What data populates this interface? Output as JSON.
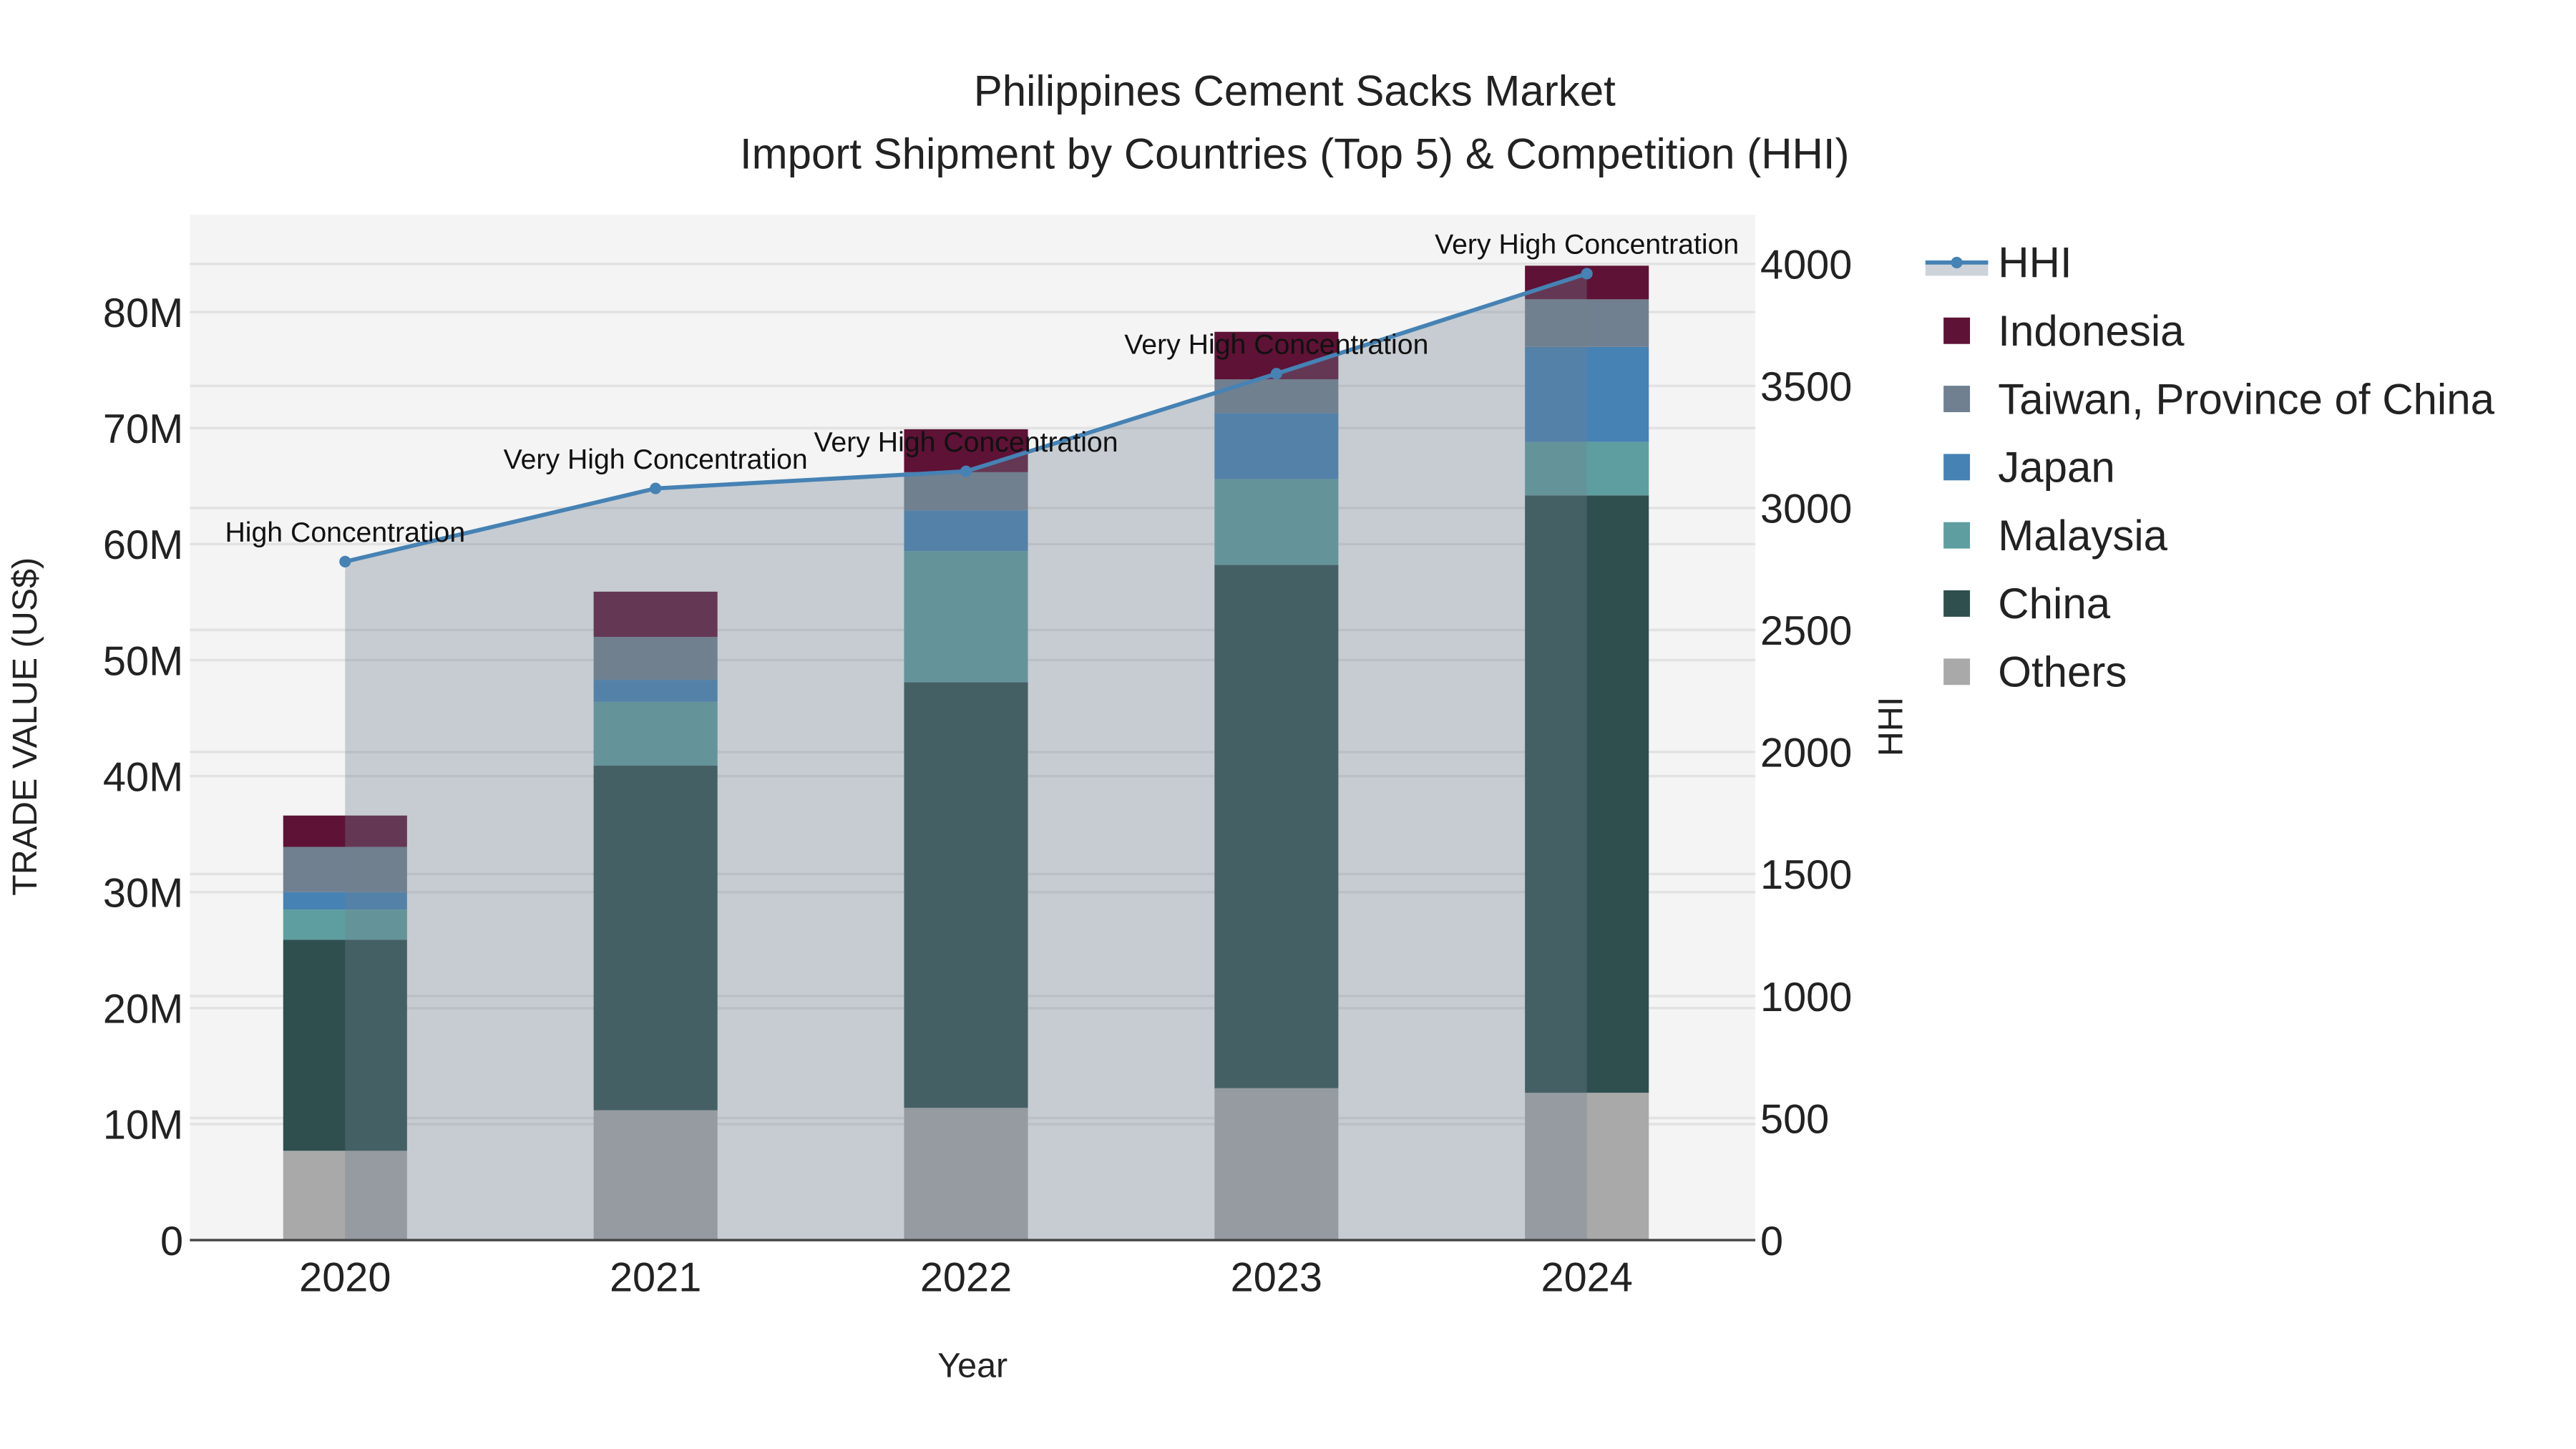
{
  "chart_data": {
    "type": "bar",
    "stacked": true,
    "title": "Philippines Cement Sacks Market",
    "subtitle": "Import Shipment by Countries (Top 5) & Competition (HHI)",
    "xlabel": "Year",
    "ylabel": "TRADE VALUE (US$)",
    "y2label": "HHI",
    "categories": [
      "2020",
      "2021",
      "2022",
      "2023",
      "2024"
    ],
    "ylim": [
      0,
      88000000
    ],
    "y_ticks": [
      0,
      10000000,
      20000000,
      30000000,
      40000000,
      50000000,
      60000000,
      70000000,
      80000000
    ],
    "y_tick_labels": [
      "0",
      "10M",
      "20M",
      "30M",
      "40M",
      "50M",
      "60M",
      "70M",
      "80M"
    ],
    "y2lim": [
      0,
      4200
    ],
    "y2_ticks": [
      0,
      500,
      1000,
      1500,
      2000,
      2500,
      3000,
      3500,
      4000
    ],
    "y2_tick_labels": [
      "0",
      "500",
      "1000",
      "1500",
      "2000",
      "2500",
      "3000",
      "3500",
      "4000"
    ],
    "grid": true,
    "legend_placement": "right",
    "series": [
      {
        "name": "Others",
        "color": "#a9a9a9",
        "values": [
          7700000,
          11200000,
          11400000,
          13100000,
          12700000
        ]
      },
      {
        "name": "China",
        "color": "#2f4f4f",
        "values": [
          18200000,
          29700000,
          36700000,
          45100000,
          51500000
        ]
      },
      {
        "name": "Malaysia",
        "color": "#5f9ea0",
        "values": [
          2600000,
          5500000,
          11300000,
          7400000,
          4600000
        ]
      },
      {
        "name": "Japan",
        "color": "#4682b4",
        "values": [
          1500000,
          1900000,
          3500000,
          5700000,
          8200000
        ]
      },
      {
        "name": "Taiwan, Province of China",
        "color": "#708090",
        "values": [
          3900000,
          3700000,
          3300000,
          2900000,
          4100000
        ]
      },
      {
        "name": "Indonesia",
        "color": "#5e1235",
        "values": [
          2700000,
          3900000,
          3700000,
          4100000,
          2900000
        ]
      }
    ],
    "line": {
      "name": "HHI",
      "axis": "y2",
      "color": "#4682b4",
      "area_fill": "rgba(112,128,144,0.35)",
      "values": [
        2780,
        3080,
        3150,
        3550,
        3960
      ],
      "annotations": [
        "High Concentration",
        "Very High Concentration",
        "Very High Concentration",
        "Very High Concentration",
        "Very High Concentration"
      ]
    },
    "legend_order": [
      "HHI",
      "Indonesia",
      "Taiwan, Province of China",
      "Japan",
      "Malaysia",
      "China",
      "Others"
    ]
  }
}
